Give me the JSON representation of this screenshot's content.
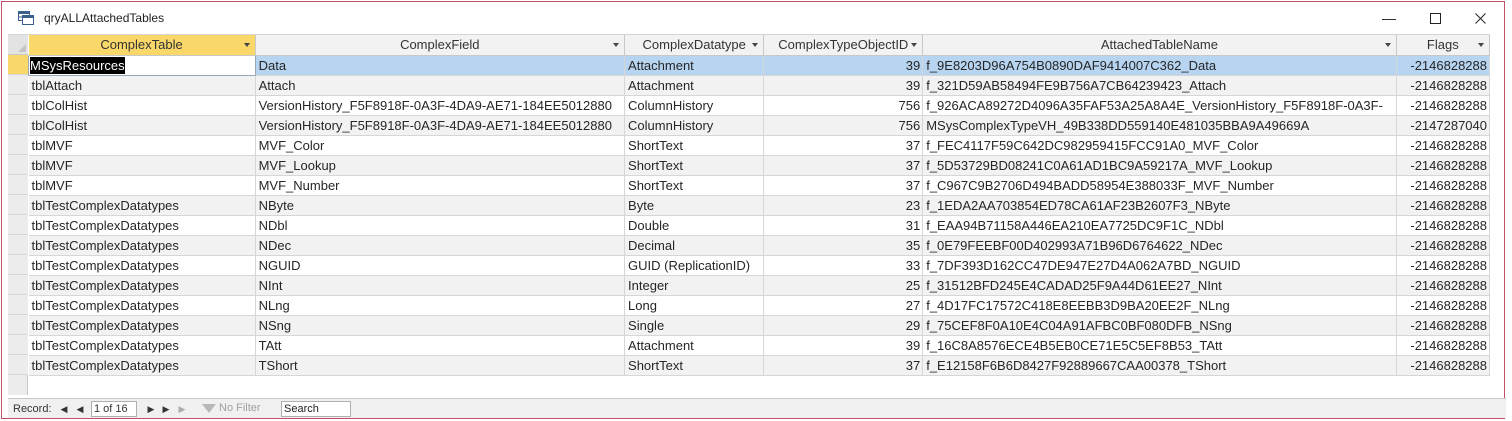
{
  "window": {
    "title": "qryALLAttachedTables"
  },
  "columns": [
    {
      "label": "ComplexTable",
      "width": 231
    },
    {
      "label": "ComplexField",
      "width": 370
    },
    {
      "label": "ComplexDatatype",
      "width": 140
    },
    {
      "label": "ComplexTypeObjectID",
      "width": 160
    },
    {
      "label": "AttachedTableName",
      "width": 474
    },
    {
      "label": "Flags",
      "width": 94
    }
  ],
  "rows": [
    [
      "MSysResources",
      "Data",
      "Attachment",
      "39",
      "f_9E8203D96A754B0890DAF9414007C362_Data",
      "-2146828288"
    ],
    [
      "tblAttach",
      "Attach",
      "Attachment",
      "39",
      "f_321D59AB58494FE9B756A7CB64239423_Attach",
      "-2146828288"
    ],
    [
      "tblColHist",
      "VersionHistory_F5F8918F-0A3F-4DA9-AE71-184EE5012880",
      "ColumnHistory",
      "756",
      "f_926ACA89272D4096A35FAF53A25A8A4E_VersionHistory_F5F8918F-0A3F-",
      "-2146828288"
    ],
    [
      "tblColHist",
      "VersionHistory_F5F8918F-0A3F-4DA9-AE71-184EE5012880",
      "ColumnHistory",
      "756",
      "MSysComplexTypeVH_49B338DD559140E481035BBA9A49669A",
      "-2147287040"
    ],
    [
      "tblMVF",
      "MVF_Color",
      "ShortText",
      "37",
      "f_FEC4117F59C642DC982959415FCC91A0_MVF_Color",
      "-2146828288"
    ],
    [
      "tblMVF",
      "MVF_Lookup",
      "ShortText",
      "37",
      "f_5D53729BD08241C0A61AD1BC9A59217A_MVF_Lookup",
      "-2146828288"
    ],
    [
      "tblMVF",
      "MVF_Number",
      "ShortText",
      "37",
      "f_C967C9B2706D494BADD58954E388033F_MVF_Number",
      "-2146828288"
    ],
    [
      "tblTestComplexDatatypes",
      "NByte",
      "Byte",
      "23",
      "f_1EDA2AA703854ED78CA61AF23B2607F3_NByte",
      "-2146828288"
    ],
    [
      "tblTestComplexDatatypes",
      "NDbl",
      "Double",
      "31",
      "f_EAA94B71158A446EA210EA7725DC9F1C_NDbl",
      "-2146828288"
    ],
    [
      "tblTestComplexDatatypes",
      "NDec",
      "Decimal",
      "35",
      "f_0E79FEEBF00D402993A71B96D6764622_NDec",
      "-2146828288"
    ],
    [
      "tblTestComplexDatatypes",
      "NGUID",
      "GUID (ReplicationID)",
      "33",
      "f_7DF393D162CC47DE947E27D4A062A7BD_NGUID",
      "-2146828288"
    ],
    [
      "tblTestComplexDatatypes",
      "NInt",
      "Integer",
      "25",
      "f_31512BFD245E4CADAD25F9A44D61EE27_NInt",
      "-2146828288"
    ],
    [
      "tblTestComplexDatatypes",
      "NLng",
      "Long",
      "27",
      "f_4D17FC17572C418E8EEBB3D9BA20EE2F_NLng",
      "-2146828288"
    ],
    [
      "tblTestComplexDatatypes",
      "NSng",
      "Single",
      "29",
      "f_75CEF8F0A10E4C04A91AFBC0BF080DFB_NSng",
      "-2146828288"
    ],
    [
      "tblTestComplexDatatypes",
      "TAtt",
      "Attachment",
      "39",
      "f_16C8A8576ECE4B5EB0CE71E5C5EF8B53_TAtt",
      "-2146828288"
    ],
    [
      "tblTestComplexDatatypes",
      "TShort",
      "ShortText",
      "37",
      "f_E12158F6B6D8427F92889667CAA00378_TShort",
      "-2146828288"
    ]
  ],
  "navigation": {
    "record_label": "Record:",
    "position": "1 of 16",
    "filter_label": "No Filter",
    "search_value": "Search"
  }
}
